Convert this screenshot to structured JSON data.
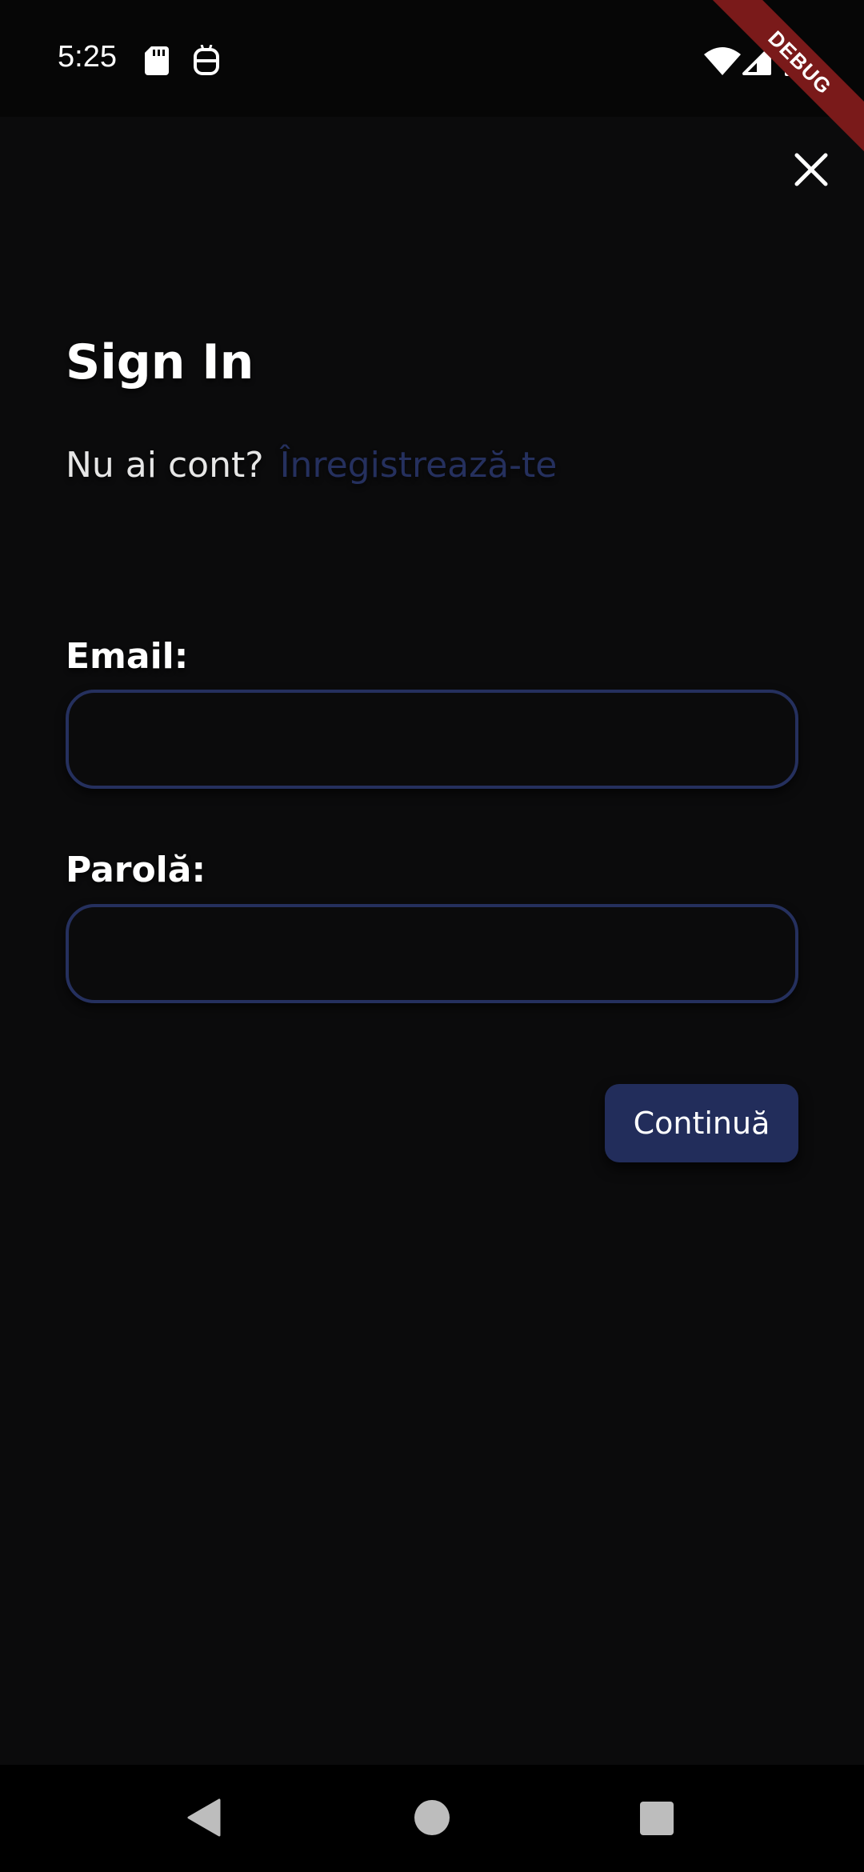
{
  "status_bar": {
    "time": "5:25",
    "icons": [
      "sd-card-icon",
      "android-bot-icon",
      "wifi-icon",
      "signal-icon",
      "battery-icon"
    ]
  },
  "debug_banner": {
    "label": "DEBUG",
    "color": "#7a1a1a"
  },
  "header": {
    "close_icon": "close-icon"
  },
  "main": {
    "title": "Sign In",
    "signup_prompt": "Nu ai cont?",
    "signup_link": "Înregistrează-te",
    "email_label": "Email:",
    "email_value": "",
    "password_label": "Parolă:",
    "password_value": "",
    "continue_label": "Continuă"
  },
  "nav_bar": {
    "icons": [
      "back-icon",
      "home-icon",
      "recents-icon"
    ]
  },
  "colors": {
    "background": "#0b0b0c",
    "accent": "#25305e",
    "button": "#222d5b",
    "text": "#ffffff"
  }
}
